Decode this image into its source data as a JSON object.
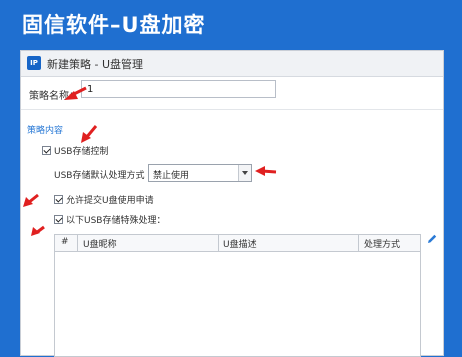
{
  "banner": {
    "title": "固信软件–U盘加密"
  },
  "window": {
    "icon_text": "IP",
    "title": "新建策略 - U盘管理"
  },
  "form": {
    "name_label": "策略名称：",
    "name_value": "1"
  },
  "section": {
    "title": "策略内容"
  },
  "options": {
    "usb_control": "USB存储控制",
    "default_method_label": "USB存储默认处理方式",
    "default_method_value": "禁止使用",
    "allow_apply": "允许提交U盘使用申请",
    "special_handling": "以下USB存储特殊处理："
  },
  "table": {
    "columns": [
      "#",
      "U盘昵称",
      "U盘描述",
      "处理方式"
    ]
  },
  "colors": {
    "banner": "#1f6fd0",
    "accent": "#2a7ad6",
    "arrow": "#e02020"
  }
}
